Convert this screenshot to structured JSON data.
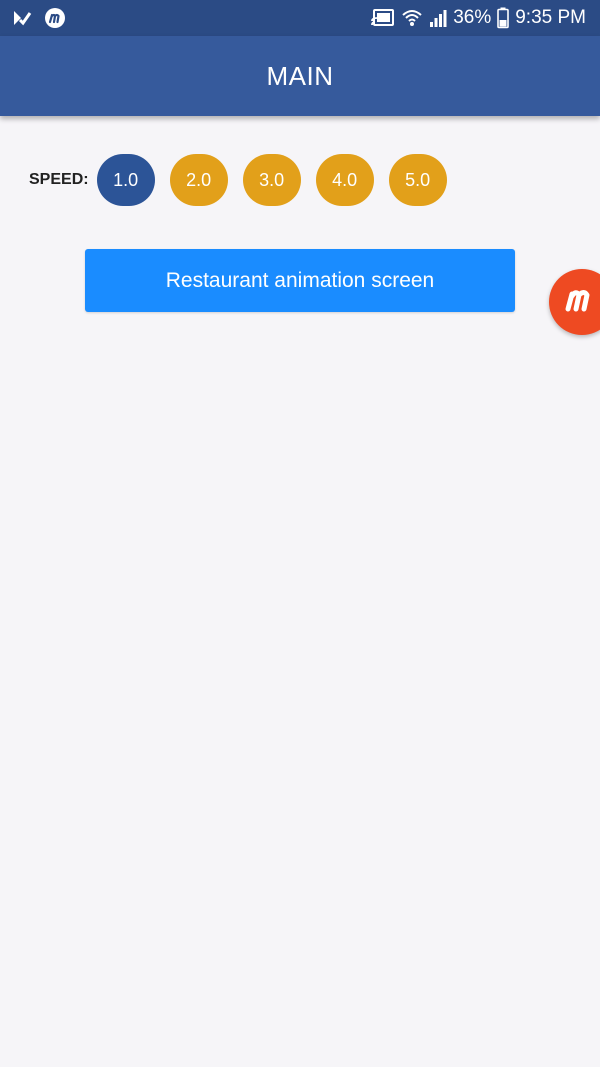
{
  "status_bar": {
    "battery": "36%",
    "time": "9:35 PM",
    "icons": [
      "notification-check-icon",
      "mobizen-icon",
      "cast-icon",
      "wifi-icon",
      "signal-icon",
      "battery-icon"
    ]
  },
  "app_bar": {
    "title": "MAIN"
  },
  "speed": {
    "label": "SPEED:",
    "options": [
      {
        "label": "1.0",
        "selected": true
      },
      {
        "label": "2.0",
        "selected": false
      },
      {
        "label": "3.0",
        "selected": false
      },
      {
        "label": "4.0",
        "selected": false
      },
      {
        "label": "5.0",
        "selected": false
      }
    ]
  },
  "main": {
    "restaurant_button_label": "Restaurant animation screen"
  },
  "floating_bubble": {
    "icon": "mobizen-icon",
    "color": "#ee4a22"
  },
  "colors": {
    "status_bar": "#2b4b85",
    "app_bar": "#365a9c",
    "speed_selected": "#2c5497",
    "speed_unselected": "#e2a01a",
    "primary_button": "#1a8cff",
    "background": "#f6f5f8"
  }
}
